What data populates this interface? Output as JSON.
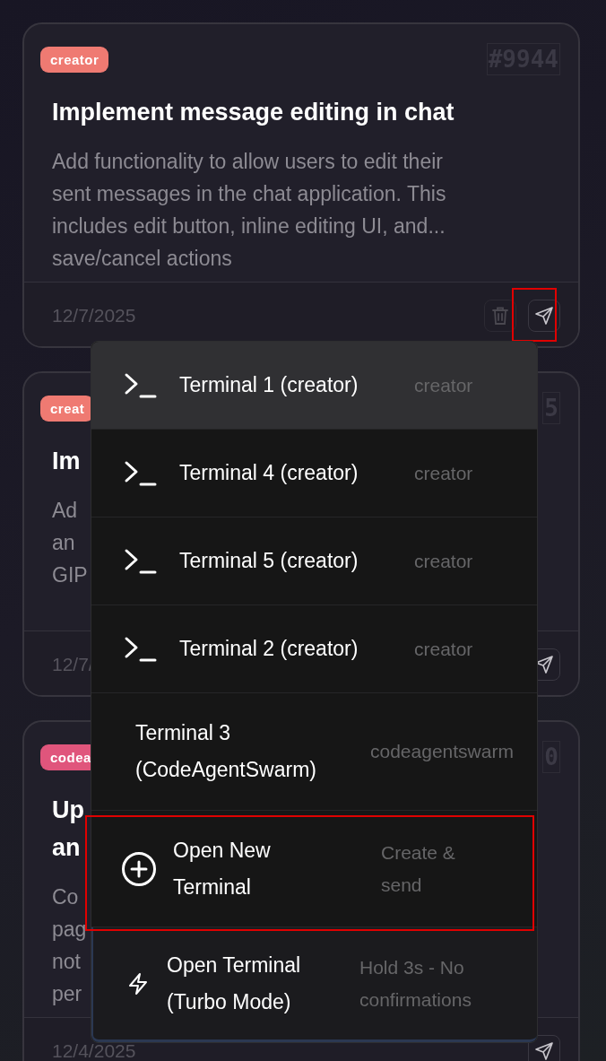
{
  "cards": [
    {
      "badge": "creator",
      "color": "#ef7a72",
      "id": "#9944",
      "title_lines": [
        "Implement message editing in chat"
      ],
      "description_lines": [
        "Add functionality to allow users to edit their",
        "sent messages in the chat application. This",
        "includes edit button, inline editing UI, and...",
        "save/cancel actions"
      ],
      "date": "12/7/2025",
      "delete_button": true
    },
    {
      "badge": "creat",
      "color": "#ef7a72",
      "id": "5",
      "title_lines": [
        "Im"
      ],
      "description_lines": [
        "Ad",
        "an",
        "GIP"
      ],
      "date": "12/7/",
      "delete_button": false
    },
    {
      "badge": "codea",
      "color": "#e0557c",
      "id": "0",
      "title_lines": [
        "Up",
        "an"
      ],
      "description_lines": [
        "Co",
        "pag",
        "not",
        "per"
      ],
      "date": "12/4/2025",
      "delete_button": false
    }
  ],
  "menu": {
    "items": [
      {
        "kind": "terminal",
        "icon": true,
        "label": "Terminal 1 (creator)",
        "detail": "creator",
        "highlighted": true
      },
      {
        "kind": "terminal",
        "icon": true,
        "label": "Terminal 4 (creator)",
        "detail": "creator",
        "highlighted": false
      },
      {
        "kind": "terminal",
        "icon": true,
        "label": "Terminal 5 (creator)",
        "detail": "creator",
        "highlighted": false
      },
      {
        "kind": "terminal",
        "icon": true,
        "label": "Terminal 2 (creator)",
        "detail": "creator",
        "highlighted": false
      },
      {
        "kind": "terminal",
        "icon": false,
        "label": "Terminal 3 (CodeAgentSwarm)",
        "detail": "codeagentswarm",
        "highlighted": false
      },
      {
        "kind": "new",
        "icon": true,
        "label": "Open New Terminal",
        "detail": "Create & send",
        "highlighted": false
      },
      {
        "kind": "turbo",
        "icon": true,
        "label": "Open Terminal (Turbo Mode)",
        "detail": "Hold 3s - No confirmations",
        "highlighted": false
      }
    ]
  }
}
